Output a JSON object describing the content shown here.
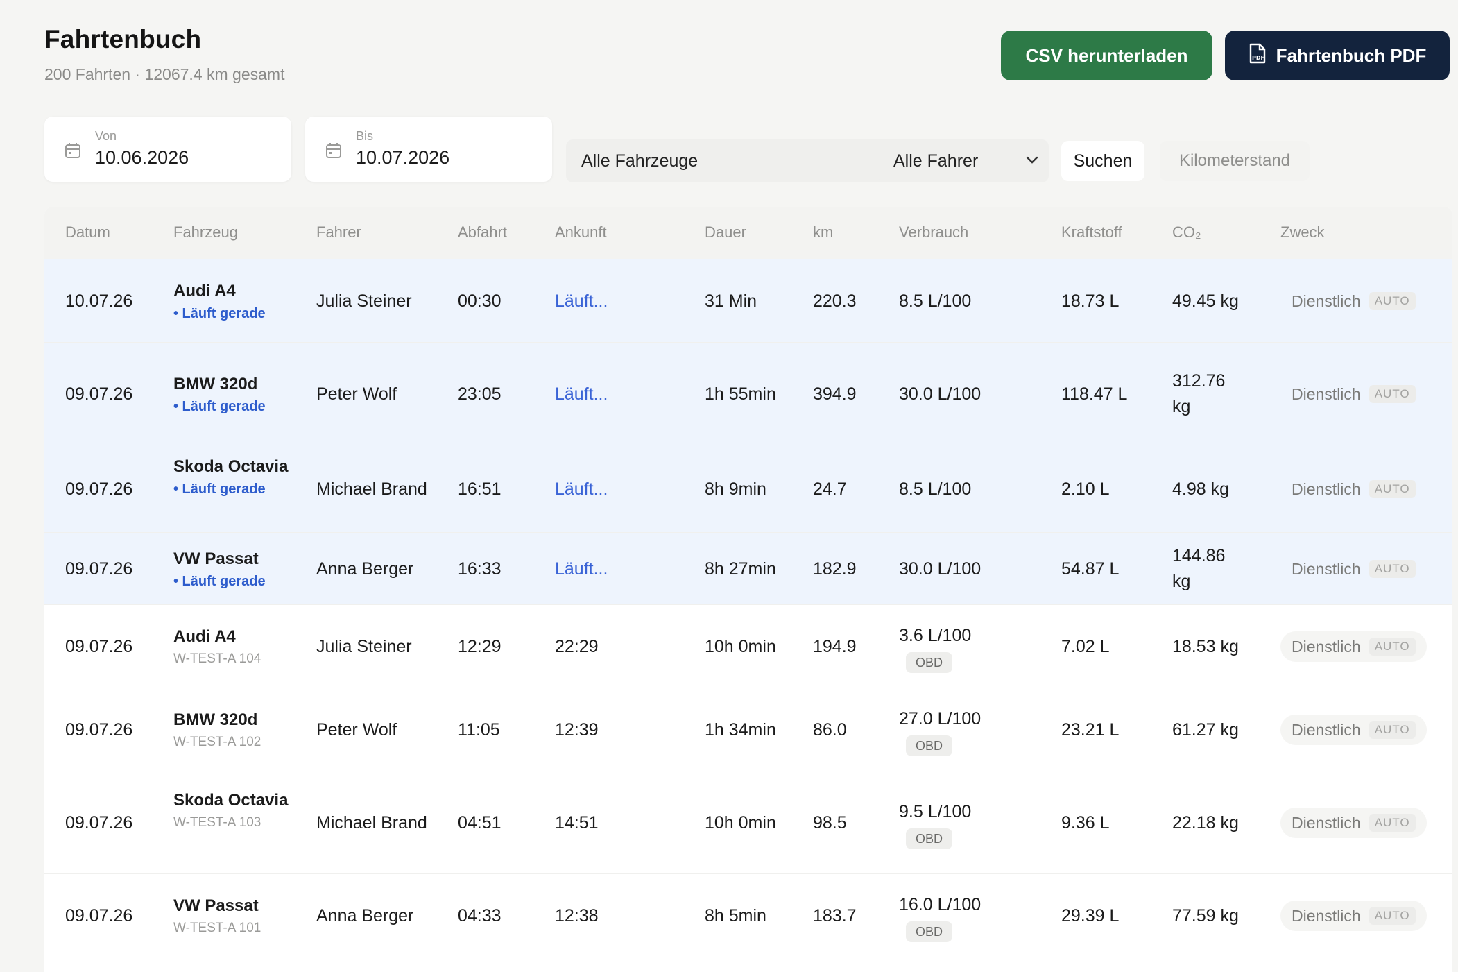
{
  "header": {
    "title": "Fahrtenbuch",
    "subtitle": "200 Fahrten · 12067.4 km gesamt",
    "csv_button": "CSV herunterladen",
    "pdf_button": "Fahrtenbuch PDF"
  },
  "filters": {
    "from_label": "Von",
    "from_value": "10.06.2026",
    "to_label": "Bis",
    "to_value": "10.07.2026",
    "vehicle_select": "Alle Fahrzeuge",
    "driver_select": "Alle Fahrer",
    "search_button": "Suchen",
    "mileage_placeholder": "Kilometerstand"
  },
  "colors": {
    "csv_button": "#2d7a47",
    "pdf_button": "#13233d",
    "live_row": "#eef4fd",
    "live_text": "#2d5ccc"
  },
  "table": {
    "columns": [
      "Datum",
      "Fahrzeug",
      "Fahrer",
      "Abfahrt",
      "Ankunft",
      "Dauer",
      "km",
      "Verbrauch",
      "Kraftstoff",
      "CO₂",
      "Zweck"
    ],
    "rows": [
      {
        "date": "10.07.26",
        "vehicle": "Audi A4",
        "vehicle_sub": "• Läuft gerade",
        "driver": "Julia Steiner",
        "departure": "00:30",
        "arrival": "Läuft...",
        "duration": "31 Min",
        "km": "220.3",
        "consumption": "8.5 L/100",
        "obd": "",
        "fuel": "18.73 L",
        "co2": "49.45 kg",
        "purpose": "Dienstlich",
        "badge": "AUTO"
      },
      {
        "date": "09.07.26",
        "vehicle": "BMW 320d",
        "vehicle_sub": "• Läuft gerade",
        "driver": "Peter Wolf",
        "departure": "23:05",
        "arrival": "Läuft...",
        "duration": "1h 55min",
        "km": "394.9",
        "consumption": "30.0 L/100",
        "obd": "",
        "fuel": "118.47 L",
        "co2": "312.76 kg",
        "purpose": "Dienstlich",
        "badge": "AUTO"
      },
      {
        "date": "09.07.26",
        "vehicle": "Skoda Octavia",
        "vehicle_sub": "• Läuft gerade",
        "driver": "Michael Brand",
        "departure": "16:51",
        "arrival": "Läuft...",
        "duration": "8h 9min",
        "km": "24.7",
        "consumption": "8.5 L/100",
        "obd": "",
        "fuel": "2.10 L",
        "co2": "4.98 kg",
        "purpose": "Dienstlich",
        "badge": "AUTO"
      },
      {
        "date": "09.07.26",
        "vehicle": "VW Passat",
        "vehicle_sub": "• Läuft gerade",
        "driver": "Anna Berger",
        "departure": "16:33",
        "arrival": "Läuft...",
        "duration": "8h 27min",
        "km": "182.9",
        "consumption": "30.0 L/100",
        "obd": "",
        "fuel": "54.87 L",
        "co2": "144.86 kg",
        "purpose": "Dienstlich",
        "badge": "AUTO"
      },
      {
        "date": "09.07.26",
        "vehicle": "Audi A4",
        "vehicle_sub": "W-TEST-A 104",
        "driver": "Julia Steiner",
        "departure": "12:29",
        "arrival": "22:29",
        "duration": "10h 0min",
        "km": "194.9",
        "consumption": "3.6 L/100",
        "obd": "OBD",
        "fuel": "7.02 L",
        "co2": "18.53 kg",
        "purpose": "Dienstlich",
        "badge": "AUTO"
      },
      {
        "date": "09.07.26",
        "vehicle": "BMW 320d",
        "vehicle_sub": "W-TEST-A 102",
        "driver": "Peter Wolf",
        "departure": "11:05",
        "arrival": "12:39",
        "duration": "1h 34min",
        "km": "86.0",
        "consumption": "27.0 L/100",
        "obd": "OBD",
        "fuel": "23.21 L",
        "co2": "61.27 kg",
        "purpose": "Dienstlich",
        "badge": "AUTO"
      },
      {
        "date": "09.07.26",
        "vehicle": "Skoda Octavia",
        "vehicle_sub": "W-TEST-A 103",
        "driver": "Michael Brand",
        "departure": "04:51",
        "arrival": "14:51",
        "duration": "10h 0min",
        "km": "98.5",
        "consumption": "9.5 L/100",
        "obd": "OBD",
        "fuel": "9.36 L",
        "co2": "22.18 kg",
        "purpose": "Dienstlich",
        "badge": "AUTO"
      },
      {
        "date": "09.07.26",
        "vehicle": "VW Passat",
        "vehicle_sub": "W-TEST-A 101",
        "driver": "Anna Berger",
        "departure": "04:33",
        "arrival": "12:38",
        "duration": "8h 5min",
        "km": "183.7",
        "consumption": "16.0 L/100",
        "obd": "OBD",
        "fuel": "29.39 L",
        "co2": "77.59 kg",
        "purpose": "Dienstlich",
        "badge": "AUTO"
      }
    ]
  }
}
